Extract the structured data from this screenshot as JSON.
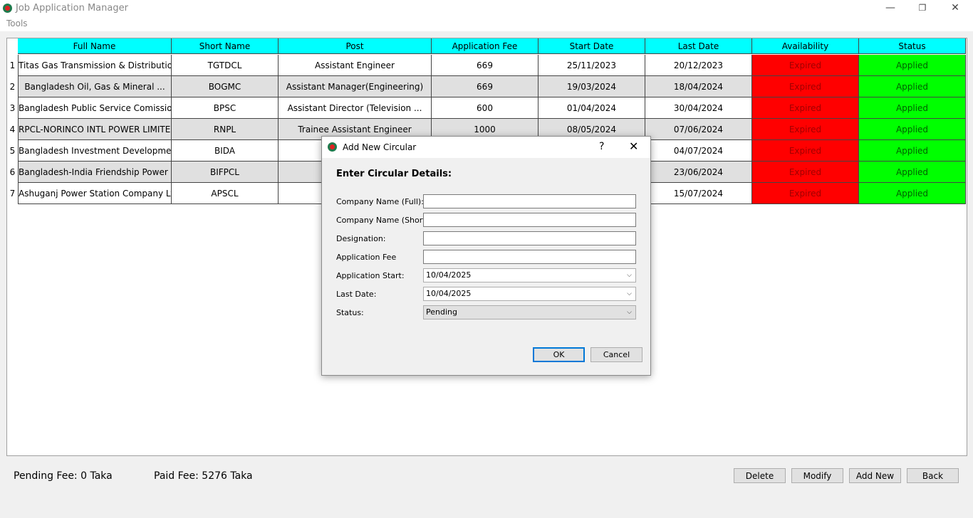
{
  "window": {
    "title": "Job Application Manager",
    "minimize": "—",
    "restore": "❐",
    "close": "✕"
  },
  "menu": {
    "tools": "Tools"
  },
  "table": {
    "columns": [
      "Full Name",
      "Short Name",
      "Post",
      "Application Fee",
      "Start Date",
      "Last Date",
      "Availability",
      "Status"
    ],
    "rows": [
      {
        "num": "1",
        "full": "Titas Gas Transmission & Distribution ...",
        "short": "TGTDCL",
        "post": "Assistant Engineer",
        "fee": "669",
        "start": "25/11/2023",
        "last": "20/12/2023",
        "avail": "Expired",
        "status": "Applied"
      },
      {
        "num": "2",
        "full": "Bangladesh Oil, Gas & Mineral ...",
        "short": "BOGMC",
        "post": "Assistant Manager(Engineering)",
        "fee": "669",
        "start": "19/03/2024",
        "last": "18/04/2024",
        "avail": "Expired",
        "status": "Applied"
      },
      {
        "num": "3",
        "full": "Bangladesh Public Service Comission",
        "short": "BPSC",
        "post": "Assistant Director (Television ...",
        "fee": "600",
        "start": "01/04/2024",
        "last": "30/04/2024",
        "avail": "Expired",
        "status": "Applied"
      },
      {
        "num": "4",
        "full": "RPCL-NORINCO INTL POWER LIMITED",
        "short": "RNPL",
        "post": "Trainee Assistant Engineer",
        "fee": "1000",
        "start": "08/05/2024",
        "last": "07/06/2024",
        "avail": "Expired",
        "status": "Applied"
      },
      {
        "num": "5",
        "full": "Bangladesh Investment Development ...",
        "short": "BIDA",
        "post": "",
        "fee": "",
        "start": "",
        "last": "04/07/2024",
        "avail": "Expired",
        "status": "Applied"
      },
      {
        "num": "6",
        "full": "Bangladesh-India Friendship Power ...",
        "short": "BIFPCL",
        "post": "Assist",
        "fee": "",
        "start": "",
        "last": "23/06/2024",
        "avail": "Expired",
        "status": "Applied"
      },
      {
        "num": "7",
        "full": "Ashuganj Power Station Company Ltd.",
        "short": "APSCL",
        "post": "A",
        "fee": "",
        "start": "",
        "last": "15/07/2024",
        "avail": "Expired",
        "status": "Applied"
      }
    ]
  },
  "footer": {
    "pending": "Pending Fee: 0 Taka",
    "paid": "Paid Fee: 5276 Taka",
    "delete": "Delete",
    "modify": "Modify",
    "add_new": "Add New",
    "back": "Back"
  },
  "dialog": {
    "title": "Add New Circular",
    "help": "?",
    "close": "✕",
    "heading": "Enter Circular Details:",
    "labels": {
      "company_full": "Company Name (Full):",
      "company_short": "Company Name (Short):",
      "designation": "Designation:",
      "fee": "Application Fee",
      "start": "Application Start:",
      "last": "Last Date:",
      "status": "Status:"
    },
    "values": {
      "company_full": "",
      "company_short": "",
      "designation": "",
      "fee": "",
      "start": "10/04/2025",
      "last": "10/04/2025",
      "status": "Pending"
    },
    "ok": "OK",
    "cancel": "Cancel"
  },
  "colors": {
    "header": "#00ffff",
    "expired": "#ff0000",
    "applied": "#00ff00",
    "accent": "#0078d7"
  }
}
